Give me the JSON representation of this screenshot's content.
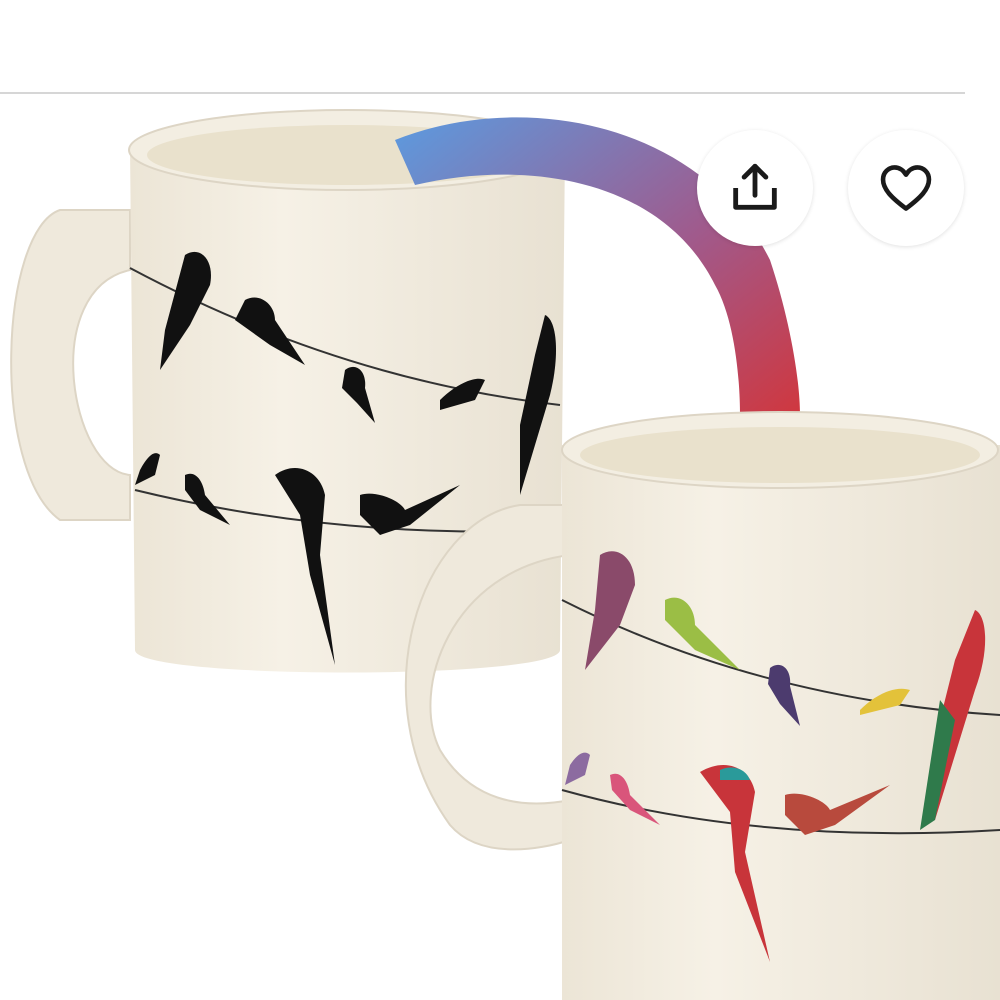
{
  "product_image": {
    "alt": "",
    "background": "#ffffff",
    "arrow_colors": [
      "#5b9be0",
      "#a05a8c",
      "#e02b24"
    ]
  },
  "actions": {
    "share": {
      "icon": "share-icon"
    },
    "favorite": {
      "icon": "heart-outline-icon"
    }
  },
  "colors": {
    "divider": "#d6d6d6",
    "button_bg": "#ffffff",
    "icon_stroke": "#1a1a1a"
  }
}
